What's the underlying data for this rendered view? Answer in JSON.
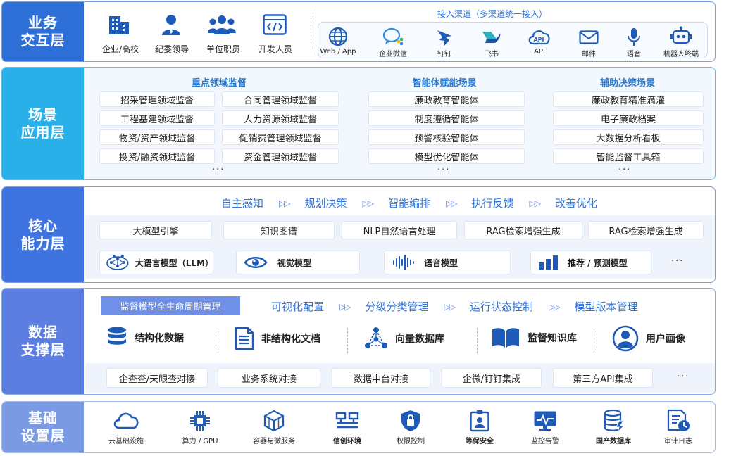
{
  "colors": {
    "accent": "#2e73d9",
    "label_dark": "#2d6fd6",
    "label_cyan": "#2ab0e8",
    "label_blue": "#3f73e0",
    "label_mid": "#5b7ee0",
    "label_light": "#7b9ae4"
  },
  "layer1": {
    "label": [
      "业务",
      "交互层"
    ],
    "users": [
      "企业/高校",
      "纪委领导",
      "单位职员",
      "开发人员"
    ],
    "channels_title": "接入渠道（多渠道统一接入）",
    "channels": [
      "Web / App",
      "企业微信",
      "钉钉",
      "飞书",
      "API",
      "邮件",
      "语音",
      "机器人终端"
    ]
  },
  "layer2": {
    "label": [
      "场景",
      "应用层"
    ],
    "col1": {
      "title": "重点领域监督",
      "left": [
        "招采管理领域监督",
        "工程基建领域监督",
        "物资/资产领域监督",
        "投资/融资领域监督"
      ],
      "right": [
        "合同管理领域监督",
        "人力资源领域监督",
        "促销费管理领域监督",
        "资金管理领域监督"
      ]
    },
    "col2": {
      "title": "智能体赋能场景",
      "items": [
        "廉政教育智能体",
        "制度遵循智能体",
        "预警核验智能体",
        "模型优化智能体"
      ]
    },
    "col3": {
      "title": "辅助决策场景",
      "items": [
        "廉政教育精准滴灌",
        "电子廉政档案",
        "大数据分析看板",
        "智能监督工具箱"
      ]
    },
    "ellipsis": "···"
  },
  "layer3": {
    "label": [
      "核心",
      "能力层"
    ],
    "flow": [
      "自主感知",
      "规划决策",
      "智能编排",
      "执行反馈",
      "改善优化"
    ],
    "arrow": "▷▷",
    "caps": [
      "大模型引擎",
      "知识图谱",
      "NLP自然语言处理",
      "RAG检索增强生成",
      "RAG检索增强生成"
    ],
    "models": [
      "大语言模型（LLM）",
      "视觉模型",
      "语音模型",
      "推荐 / 预测模型"
    ],
    "ellipsis": "···"
  },
  "layer4": {
    "label": [
      "数据",
      "支撑层"
    ],
    "tag": "监督模型全生命周期管理",
    "flow": [
      "可视化配置",
      "分级分类管理",
      "运行状态控制",
      "模型版本管理"
    ],
    "arrow": "▷▷",
    "sources": [
      "结构化数据",
      "非结构化文档",
      "向量数据库",
      "监督知识库",
      "用户画像"
    ],
    "connects": [
      "企查查/天眼查对接",
      "业务系统对接",
      "数据中台对接",
      "企微/钉钉集成",
      "第三方API集成"
    ],
    "ellipsis": "···"
  },
  "layer5": {
    "label": [
      "基础",
      "设置层"
    ],
    "items": [
      "云基础设施",
      "算力 / GPU",
      "容器与微服务",
      "信创环境",
      "权限控制",
      "等保安全",
      "监控告警",
      "国产数据库",
      "审计日志"
    ]
  }
}
